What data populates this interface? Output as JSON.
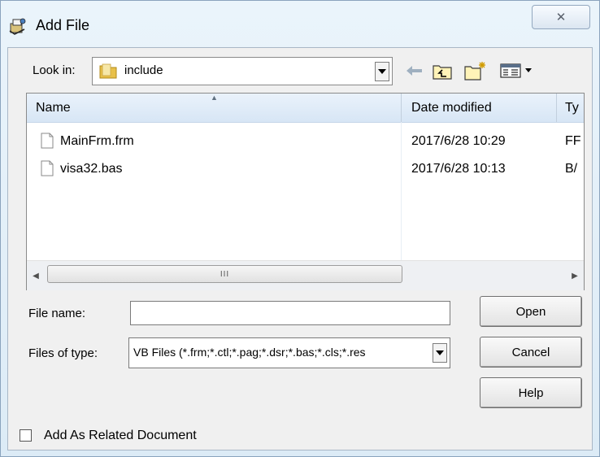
{
  "window": {
    "title": "Add File",
    "close_glyph": "✕"
  },
  "toolbar": {
    "look_in_label": "Look in:",
    "look_in_value": "include",
    "icons": [
      "back-arrow-icon",
      "up-folder-icon",
      "new-folder-icon",
      "view-menu-icon"
    ]
  },
  "file_list": {
    "columns": [
      "Name",
      "Date modified",
      "Ty"
    ],
    "rows": [
      {
        "name": "MainFrm.frm",
        "date": "2017/6/28 10:29",
        "type": "FF"
      },
      {
        "name": "visa32.bas",
        "date": "2017/6/28 10:13",
        "type": "B/"
      }
    ],
    "scroll_thumb_glyph": "III"
  },
  "form": {
    "file_name_label": "File name:",
    "file_name_value": "",
    "files_of_type_label": "Files of type:",
    "files_of_type_value": "VB Files (*.frm;*.ctl;*.pag;*.dsr;*.bas;*.cls;*.res"
  },
  "buttons": {
    "open": "Open",
    "cancel": "Cancel",
    "help": "Help"
  },
  "options": {
    "related_doc_label": "Add As Related Document",
    "related_doc_checked": false
  },
  "colors": {
    "frame": "#dcebf6",
    "client": "#f0f0f0",
    "header": "#d7e6f5"
  }
}
